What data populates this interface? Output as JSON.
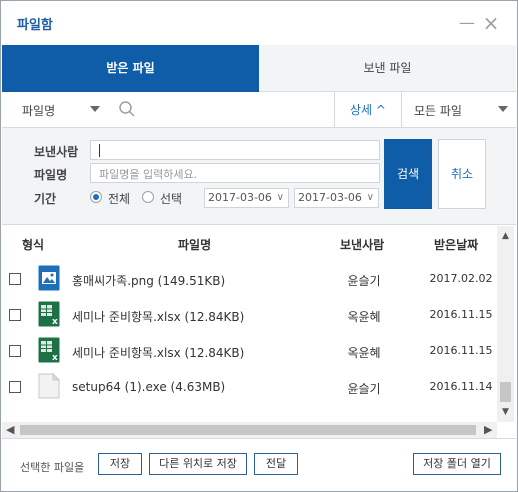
{
  "window": {
    "title": "파일함",
    "minimize_glyph": "—",
    "close_glyph": "×"
  },
  "tabs": [
    {
      "label": "받은 파일",
      "active": true
    },
    {
      "label": "보낸 파일",
      "active": false
    }
  ],
  "filterbar": {
    "field_select": "파일명",
    "search_placeholder": "",
    "detail_label": "상세 ^",
    "file_type_select": "모든 파일"
  },
  "search_panel": {
    "sender_label": "보낸사람",
    "sender_value": "",
    "filename_label": "파일명",
    "filename_placeholder": "파일명을 입력하세요.",
    "period_label": "기간",
    "radio_all_label": "전체",
    "radio_select_label": "선택",
    "selected_period": "all",
    "date_from": "2017-03-06",
    "date_to": "2017-03-06",
    "search_button": "검색",
    "cancel_button": "취소"
  },
  "file_list": {
    "columns": {
      "type": "형식",
      "name": "파일명",
      "sender": "보낸사람",
      "date": "받은날짜"
    },
    "rows": [
      {
        "icon": "image-file-icon",
        "name": "홍매씨가족.png (149.51KB)",
        "sender": "윤슬기",
        "date": "2017.02.02"
      },
      {
        "icon": "excel-file-icon",
        "name": "세미나 준비항목.xlsx (12.84KB)",
        "sender": "옥윤혜",
        "date": "2016.11.15"
      },
      {
        "icon": "excel-file-icon",
        "name": "세미나 준비항목.xlsx (12.84KB)",
        "sender": "옥윤혜",
        "date": "2016.11.15"
      },
      {
        "icon": "generic-file-icon",
        "name": "setup64 (1).exe (4.63MB)",
        "sender": "윤슬기",
        "date": "2016.11.14"
      }
    ]
  },
  "footer": {
    "selected_label": "선택한 파일을",
    "save_button": "저장",
    "save_as_button": "다른 위치로 저장",
    "forward_button": "전달",
    "open_folder_button": "저장 폴더 열기"
  },
  "colors": {
    "primary": "#0f5ca8",
    "accent_text": "#1d6fc0",
    "panel_bg": "#f3f4f6",
    "excel_green": "#1e7145",
    "image_blue": "#1e6fb8"
  }
}
